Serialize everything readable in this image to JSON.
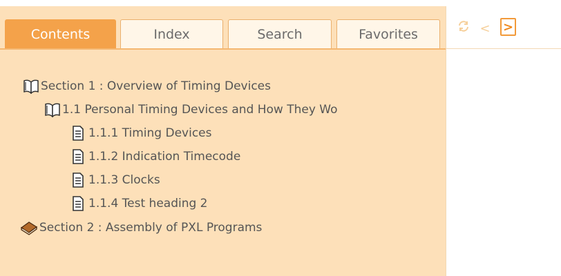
{
  "tabs": [
    {
      "label": "Contents",
      "active": true
    },
    {
      "label": "Index",
      "active": false
    },
    {
      "label": "Search",
      "active": false
    },
    {
      "label": "Favorites",
      "active": false
    }
  ],
  "tree": {
    "section1": {
      "label": "Section 1 : Overview of Timing Devices",
      "icon": "open-book-icon"
    },
    "subsection": {
      "label": "1.1 Personal Timing Devices and How They Wo",
      "icon": "open-book-icon"
    },
    "topics": [
      {
        "label": "1.1.1 Timing Devices",
        "icon": "page-icon"
      },
      {
        "label": "1.1.2 Indication Timecode",
        "icon": "page-icon"
      },
      {
        "label": "1.1.3 Clocks",
        "icon": "page-icon"
      },
      {
        "label": "1.1.4 Test heading 2",
        "icon": "page-icon"
      }
    ],
    "section2": {
      "label": "Section 2 : Assembly of PXL Programs",
      "icon": "closed-book-icon"
    }
  },
  "toolbar": {
    "sync_icon": "sync-icon",
    "prev_icon": "previous-arrow-icon",
    "next_icon": "next-arrow-icon",
    "next_glyph": ">",
    "prev_glyph": "<"
  },
  "colors": {
    "pane_bg": "#fde0b9",
    "tab_active": "#f4a24a",
    "tab_inactive": "#fff6e8",
    "tab_border": "#eab06d",
    "text": "#555555",
    "accent": "#f29a39"
  }
}
